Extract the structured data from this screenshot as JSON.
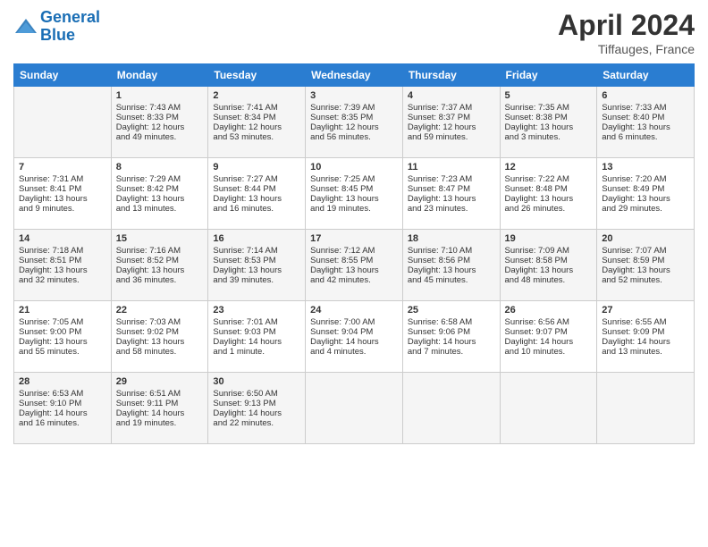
{
  "header": {
    "logo_line1": "General",
    "logo_line2": "Blue",
    "month": "April 2024",
    "location": "Tiffauges, France"
  },
  "days_of_week": [
    "Sunday",
    "Monday",
    "Tuesday",
    "Wednesday",
    "Thursday",
    "Friday",
    "Saturday"
  ],
  "weeks": [
    [
      {
        "day": "",
        "content": ""
      },
      {
        "day": "1",
        "content": "Sunrise: 7:43 AM\nSunset: 8:33 PM\nDaylight: 12 hours\nand 49 minutes."
      },
      {
        "day": "2",
        "content": "Sunrise: 7:41 AM\nSunset: 8:34 PM\nDaylight: 12 hours\nand 53 minutes."
      },
      {
        "day": "3",
        "content": "Sunrise: 7:39 AM\nSunset: 8:35 PM\nDaylight: 12 hours\nand 56 minutes."
      },
      {
        "day": "4",
        "content": "Sunrise: 7:37 AM\nSunset: 8:37 PM\nDaylight: 12 hours\nand 59 minutes."
      },
      {
        "day": "5",
        "content": "Sunrise: 7:35 AM\nSunset: 8:38 PM\nDaylight: 13 hours\nand 3 minutes."
      },
      {
        "day": "6",
        "content": "Sunrise: 7:33 AM\nSunset: 8:40 PM\nDaylight: 13 hours\nand 6 minutes."
      }
    ],
    [
      {
        "day": "7",
        "content": "Sunrise: 7:31 AM\nSunset: 8:41 PM\nDaylight: 13 hours\nand 9 minutes."
      },
      {
        "day": "8",
        "content": "Sunrise: 7:29 AM\nSunset: 8:42 PM\nDaylight: 13 hours\nand 13 minutes."
      },
      {
        "day": "9",
        "content": "Sunrise: 7:27 AM\nSunset: 8:44 PM\nDaylight: 13 hours\nand 16 minutes."
      },
      {
        "day": "10",
        "content": "Sunrise: 7:25 AM\nSunset: 8:45 PM\nDaylight: 13 hours\nand 19 minutes."
      },
      {
        "day": "11",
        "content": "Sunrise: 7:23 AM\nSunset: 8:47 PM\nDaylight: 13 hours\nand 23 minutes."
      },
      {
        "day": "12",
        "content": "Sunrise: 7:22 AM\nSunset: 8:48 PM\nDaylight: 13 hours\nand 26 minutes."
      },
      {
        "day": "13",
        "content": "Sunrise: 7:20 AM\nSunset: 8:49 PM\nDaylight: 13 hours\nand 29 minutes."
      }
    ],
    [
      {
        "day": "14",
        "content": "Sunrise: 7:18 AM\nSunset: 8:51 PM\nDaylight: 13 hours\nand 32 minutes."
      },
      {
        "day": "15",
        "content": "Sunrise: 7:16 AM\nSunset: 8:52 PM\nDaylight: 13 hours\nand 36 minutes."
      },
      {
        "day": "16",
        "content": "Sunrise: 7:14 AM\nSunset: 8:53 PM\nDaylight: 13 hours\nand 39 minutes."
      },
      {
        "day": "17",
        "content": "Sunrise: 7:12 AM\nSunset: 8:55 PM\nDaylight: 13 hours\nand 42 minutes."
      },
      {
        "day": "18",
        "content": "Sunrise: 7:10 AM\nSunset: 8:56 PM\nDaylight: 13 hours\nand 45 minutes."
      },
      {
        "day": "19",
        "content": "Sunrise: 7:09 AM\nSunset: 8:58 PM\nDaylight: 13 hours\nand 48 minutes."
      },
      {
        "day": "20",
        "content": "Sunrise: 7:07 AM\nSunset: 8:59 PM\nDaylight: 13 hours\nand 52 minutes."
      }
    ],
    [
      {
        "day": "21",
        "content": "Sunrise: 7:05 AM\nSunset: 9:00 PM\nDaylight: 13 hours\nand 55 minutes."
      },
      {
        "day": "22",
        "content": "Sunrise: 7:03 AM\nSunset: 9:02 PM\nDaylight: 13 hours\nand 58 minutes."
      },
      {
        "day": "23",
        "content": "Sunrise: 7:01 AM\nSunset: 9:03 PM\nDaylight: 14 hours\nand 1 minute."
      },
      {
        "day": "24",
        "content": "Sunrise: 7:00 AM\nSunset: 9:04 PM\nDaylight: 14 hours\nand 4 minutes."
      },
      {
        "day": "25",
        "content": "Sunrise: 6:58 AM\nSunset: 9:06 PM\nDaylight: 14 hours\nand 7 minutes."
      },
      {
        "day": "26",
        "content": "Sunrise: 6:56 AM\nSunset: 9:07 PM\nDaylight: 14 hours\nand 10 minutes."
      },
      {
        "day": "27",
        "content": "Sunrise: 6:55 AM\nSunset: 9:09 PM\nDaylight: 14 hours\nand 13 minutes."
      }
    ],
    [
      {
        "day": "28",
        "content": "Sunrise: 6:53 AM\nSunset: 9:10 PM\nDaylight: 14 hours\nand 16 minutes."
      },
      {
        "day": "29",
        "content": "Sunrise: 6:51 AM\nSunset: 9:11 PM\nDaylight: 14 hours\nand 19 minutes."
      },
      {
        "day": "30",
        "content": "Sunrise: 6:50 AM\nSunset: 9:13 PM\nDaylight: 14 hours\nand 22 minutes."
      },
      {
        "day": "",
        "content": ""
      },
      {
        "day": "",
        "content": ""
      },
      {
        "day": "",
        "content": ""
      },
      {
        "day": "",
        "content": ""
      }
    ]
  ]
}
